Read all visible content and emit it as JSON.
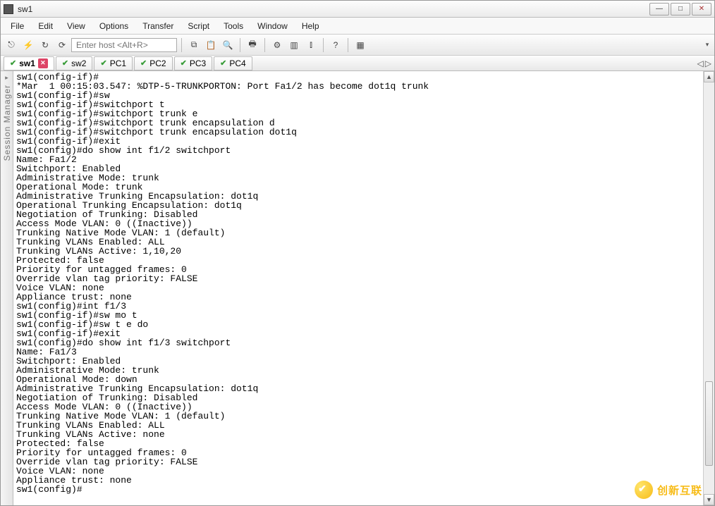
{
  "window": {
    "title": "sw1"
  },
  "menus": [
    "File",
    "Edit",
    "View",
    "Options",
    "Transfer",
    "Script",
    "Tools",
    "Window",
    "Help"
  ],
  "hostPlaceholder": "Enter host <Alt+R>",
  "tabs": [
    {
      "label": "sw1",
      "active": true,
      "closeBtn": true
    },
    {
      "label": "sw2",
      "active": false,
      "closeBtn": false
    },
    {
      "label": "PC1",
      "active": false,
      "closeBtn": false
    },
    {
      "label": "PC2",
      "active": false,
      "closeBtn": false
    },
    {
      "label": "PC3",
      "active": false,
      "closeBtn": false
    },
    {
      "label": "PC4",
      "active": false,
      "closeBtn": false
    }
  ],
  "sidebarLabel": "Session Manager",
  "terminalLines": [
    "sw1(config-if)#",
    "*Mar  1 00:15:03.547: %DTP-5-TRUNKPORTON: Port Fa1/2 has become dot1q trunk",
    "sw1(config-if)#sw",
    "sw1(config-if)#switchport t",
    "sw1(config-if)#switchport trunk e",
    "sw1(config-if)#switchport trunk encapsulation d",
    "sw1(config-if)#switchport trunk encapsulation dot1q",
    "sw1(config-if)#exit",
    "sw1(config)#do show int f1/2 switchport",
    "Name: Fa1/2",
    "Switchport: Enabled",
    "Administrative Mode: trunk",
    "Operational Mode: trunk",
    "Administrative Trunking Encapsulation: dot1q",
    "Operational Trunking Encapsulation: dot1q",
    "Negotiation of Trunking: Disabled",
    "Access Mode VLAN: 0 ((Inactive))",
    "Trunking Native Mode VLAN: 1 (default)",
    "Trunking VLANs Enabled: ALL",
    "Trunking VLANs Active: 1,10,20",
    "Protected: false",
    "Priority for untagged frames: 0",
    "Override vlan tag priority: FALSE",
    "Voice VLAN: none",
    "Appliance trust: none",
    "sw1(config)#int f1/3",
    "sw1(config-if)#sw mo t",
    "sw1(config-if)#sw t e do",
    "sw1(config-if)#exit",
    "sw1(config)#do show int f1/3 switchport",
    "Name: Fa1/3",
    "Switchport: Enabled",
    "Administrative Mode: trunk",
    "Operational Mode: down",
    "Administrative Trunking Encapsulation: dot1q",
    "Negotiation of Trunking: Disabled",
    "Access Mode VLAN: 0 ((Inactive))",
    "Trunking Native Mode VLAN: 1 (default)",
    "Trunking VLANs Enabled: ALL",
    "Trunking VLANs Active: none",
    "Protected: false",
    "Priority for untagged frames: 0",
    "Override vlan tag priority: FALSE",
    "Voice VLAN: none",
    "Appliance trust: none",
    "sw1(config)#"
  ],
  "watermark": "创新互联"
}
